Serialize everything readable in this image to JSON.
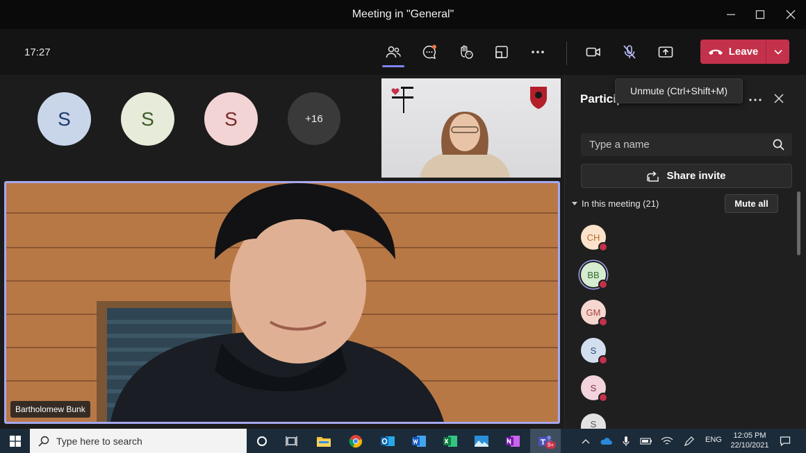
{
  "window": {
    "title": "Meeting in \"General\""
  },
  "toolbar": {
    "clock": "17:27",
    "leave_label": "Leave",
    "tooltip": "Unmute (Ctrl+Shift+M)"
  },
  "stage": {
    "avatars": [
      {
        "initial": "S",
        "bg": "#c9d6ea",
        "fg": "#1e3a6e"
      },
      {
        "initial": "S",
        "bg": "#e6ecd9",
        "fg": "#3f5a2a"
      },
      {
        "initial": "S",
        "bg": "#f3d4d4",
        "fg": "#7a2a2a"
      }
    ],
    "overflow_count": "+16",
    "main_speaker": "Bartholomew Bunk"
  },
  "panel": {
    "title": "Particip",
    "search_placeholder": "Type a name",
    "share_invite": "Share invite",
    "section_label": "In this meeting (21)",
    "mute_all": "Mute all",
    "participants": [
      {
        "initials": "CH",
        "bg": "#fbe3cb",
        "fg": "#b86a2a"
      },
      {
        "initials": "BB",
        "bg": "#d5ecd0",
        "fg": "#2f6d2f"
      },
      {
        "initials": "GM",
        "bg": "#f6d7d0",
        "fg": "#a6403a"
      },
      {
        "initials": "S",
        "bg": "#d3deef",
        "fg": "#2b4a80"
      },
      {
        "initials": "S",
        "bg": "#f3d4dc",
        "fg": "#8a2d47"
      },
      {
        "initials": "S",
        "bg": "#e2e2e2",
        "fg": "#555555"
      }
    ]
  },
  "taskbar": {
    "search_placeholder": "Type here to search",
    "lang": "ENG",
    "time": "12:05 PM",
    "date": "22/10/2021",
    "teams_badge": "9+"
  }
}
